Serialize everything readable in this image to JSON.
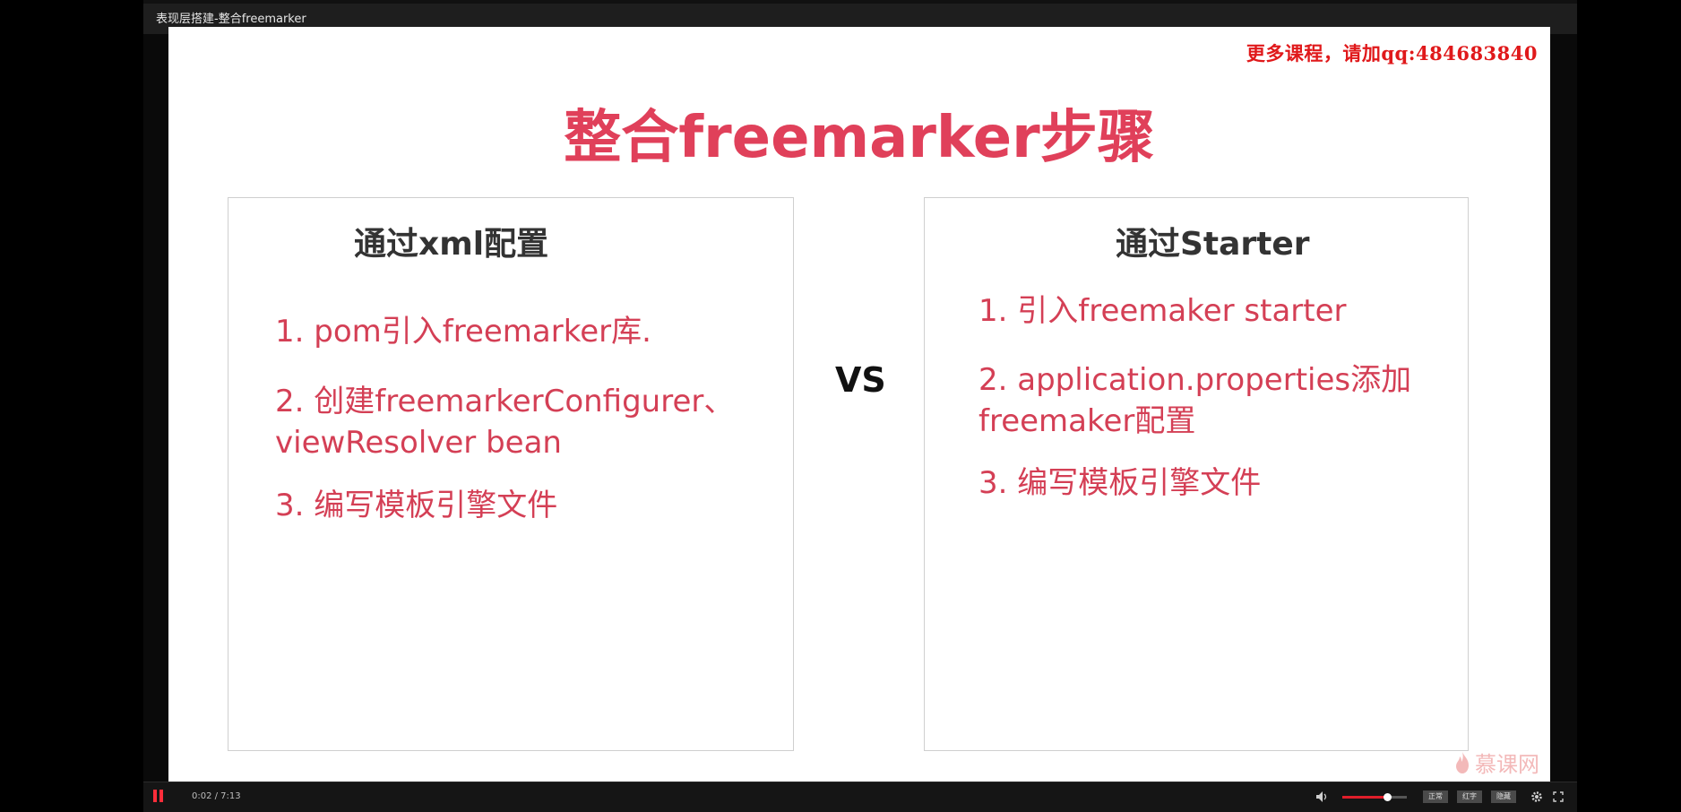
{
  "window": {
    "title": "表现层搭建-整合freemarker"
  },
  "slide": {
    "watermark": "更多课程，请加qq:484683840",
    "title": "整合freemarker步骤",
    "vs": "VS",
    "left": {
      "heading": "通过xml配置",
      "items": [
        "1. pom引入freemarker库.",
        "2. 创建freemarkerConfigurer、",
        "viewResolver bean",
        "3.  编写模板引擎文件"
      ]
    },
    "right": {
      "heading": "通过Starter",
      "items": [
        "1. 引入freemaker starter",
        "2. application.properties添加",
        "freemaker配置",
        "3. 编写模板引擎文件"
      ]
    },
    "logo_text": "慕课网"
  },
  "controls": {
    "time": "0:02 / 7:13",
    "volume_level": 0.7,
    "quality_buttons": [
      "正常",
      "红字",
      "隐藏"
    ],
    "accent_color": "#e01e2a"
  }
}
